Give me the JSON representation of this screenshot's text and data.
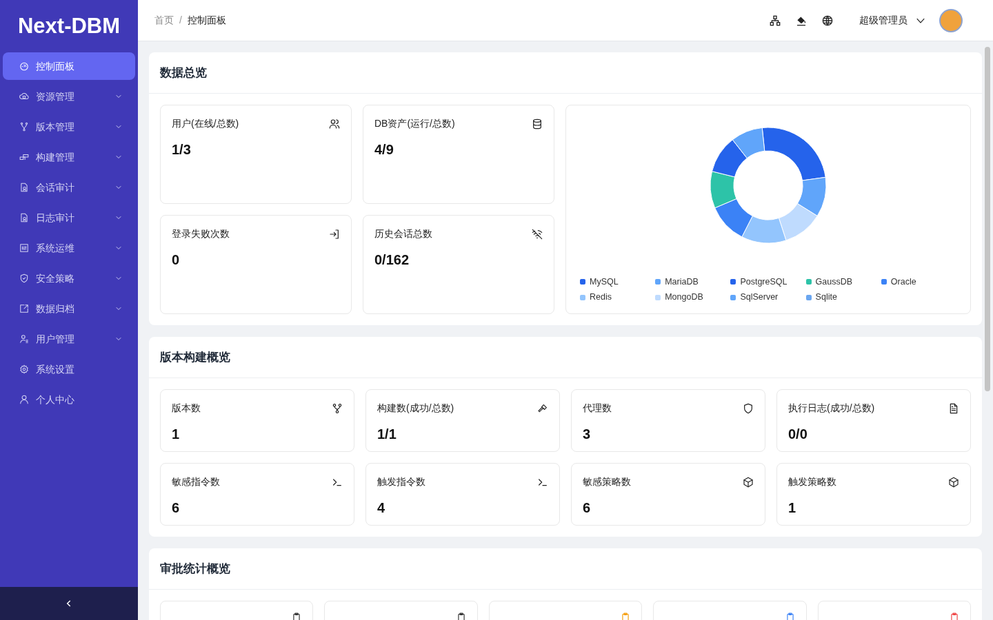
{
  "sidebar": {
    "logo": "Next-DBM",
    "items": [
      {
        "label": "控制面板",
        "selected": true,
        "expandable": false
      },
      {
        "label": "资源管理",
        "selected": false,
        "expandable": true
      },
      {
        "label": "版本管理",
        "selected": false,
        "expandable": true
      },
      {
        "label": "构建管理",
        "selected": false,
        "expandable": true
      },
      {
        "label": "会话审计",
        "selected": false,
        "expandable": true
      },
      {
        "label": "日志审计",
        "selected": false,
        "expandable": true
      },
      {
        "label": "系统运维",
        "selected": false,
        "expandable": true
      },
      {
        "label": "安全策略",
        "selected": false,
        "expandable": true
      },
      {
        "label": "数据归档",
        "selected": false,
        "expandable": true
      },
      {
        "label": "用户管理",
        "selected": false,
        "expandable": true
      },
      {
        "label": "系统设置",
        "selected": false,
        "expandable": false
      },
      {
        "label": "个人中心",
        "selected": false,
        "expandable": false
      }
    ]
  },
  "header": {
    "breadcrumb": [
      "首页",
      "控制面板"
    ],
    "breadcrumb_separator": "/",
    "user": "超级管理员"
  },
  "overview": {
    "title": "数据总览",
    "cards": [
      {
        "label": "用户(在线/总数)",
        "value": "1/3"
      },
      {
        "label": "DB资产(运行/总数)",
        "value": "4/9"
      },
      {
        "label": "登录失败次数",
        "value": "0"
      },
      {
        "label": "历史会话总数",
        "value": "0/162"
      }
    ],
    "legend": [
      {
        "label": "MySQL",
        "color": "#2563eb"
      },
      {
        "label": "MariaDB",
        "color": "#60a5fa"
      },
      {
        "label": "PostgreSQL",
        "color": "#2563eb"
      },
      {
        "label": "GaussDB",
        "color": "#2dc3a8"
      },
      {
        "label": "Oracle",
        "color": "#3b82f6"
      },
      {
        "label": "Redis",
        "color": "#93c5fd"
      },
      {
        "label": "MongoDB",
        "color": "#bfdbfe"
      },
      {
        "label": "SqlServer",
        "color": "#60a5fa"
      },
      {
        "label": "Sqlite",
        "color": "#6aa6f0"
      }
    ]
  },
  "builds": {
    "title": "版本构建概览",
    "cards": [
      {
        "label": "版本数",
        "value": "1"
      },
      {
        "label": "构建数(成功/总数)",
        "value": "1/1"
      },
      {
        "label": "代理数",
        "value": "3"
      },
      {
        "label": "执行日志(成功/总数)",
        "value": "0/0"
      },
      {
        "label": "敏感指令数",
        "value": "6"
      },
      {
        "label": "触发指令数",
        "value": "4"
      },
      {
        "label": "敏感策略数",
        "value": "6"
      },
      {
        "label": "触发策略数",
        "value": "1"
      }
    ]
  },
  "approvals": {
    "title": "审批统计概览",
    "cards": [
      {
        "color": "#333333"
      },
      {
        "color": "#333333"
      },
      {
        "color": "#f59e0b"
      },
      {
        "color": "#3b82f6"
      },
      {
        "color": "#ef4444"
      }
    ]
  }
}
